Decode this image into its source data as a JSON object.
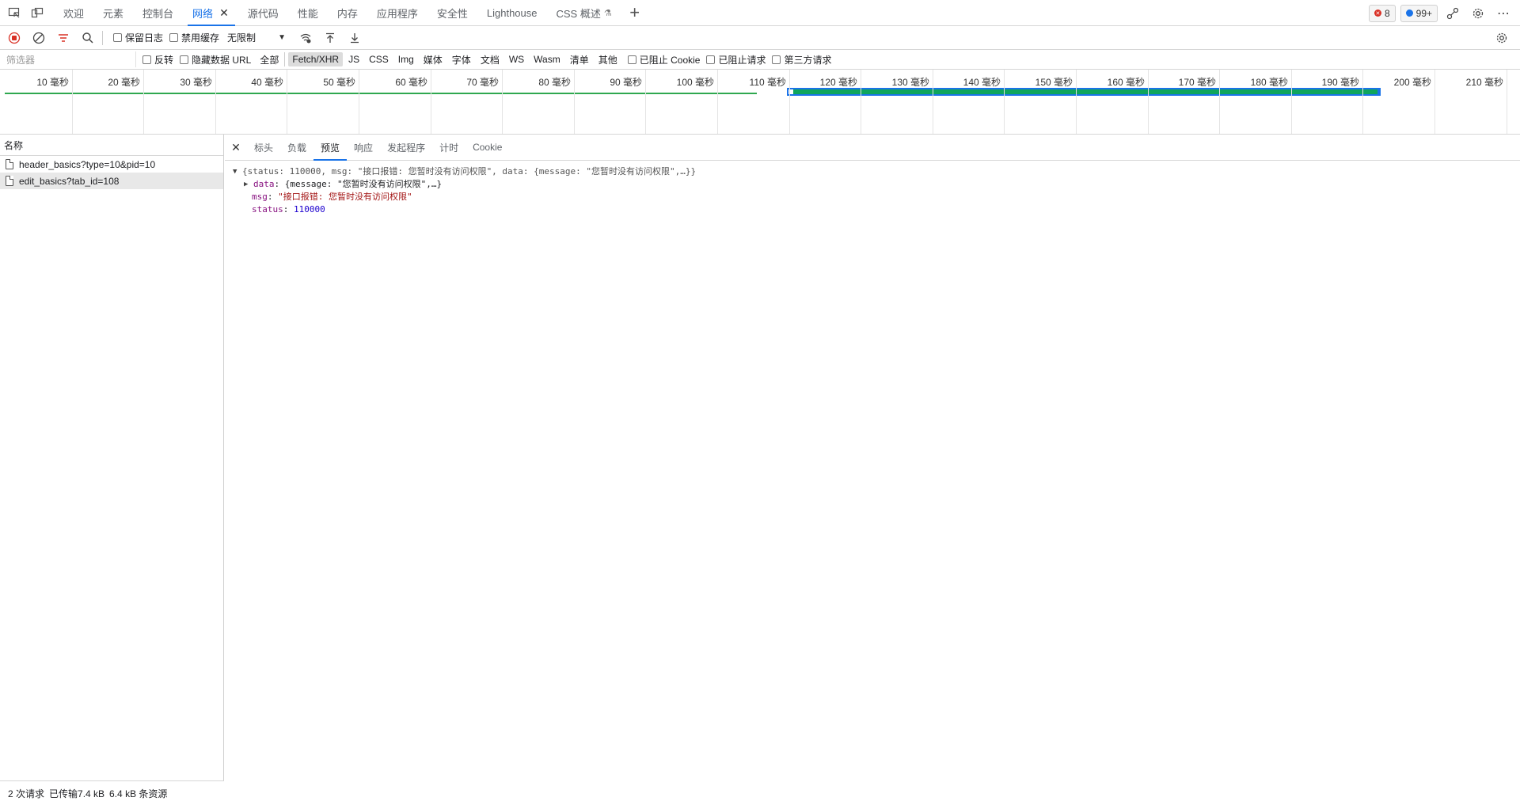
{
  "tabstrip": {
    "tabs": [
      {
        "label": "欢迎"
      },
      {
        "label": "元素"
      },
      {
        "label": "控制台"
      },
      {
        "label": "网络"
      },
      {
        "label": "源代码"
      },
      {
        "label": "性能"
      },
      {
        "label": "内存"
      },
      {
        "label": "应用程序"
      },
      {
        "label": "安全性"
      },
      {
        "label": "Lighthouse"
      },
      {
        "label": "CSS 概述"
      }
    ],
    "active_tab": "网络",
    "error_count": "8",
    "issue_count": "99+"
  },
  "toolbar": {
    "preserve_log": "保留日志",
    "disable_cache": "禁用缓存",
    "throttling": "无限制"
  },
  "filterbar": {
    "filter_placeholder": "筛选器",
    "invert": "反转",
    "hide_data_urls": "隐藏数据 URL",
    "types": [
      "全部",
      "Fetch/XHR",
      "JS",
      "CSS",
      "Img",
      "媒体",
      "字体",
      "文档",
      "WS",
      "Wasm",
      "清单",
      "其他"
    ],
    "active_type": "Fetch/XHR",
    "blocked_cookies": "已阻止 Cookie",
    "blocked_requests": "已阻止请求",
    "third_party": "第三方请求"
  },
  "timeline": {
    "ticks": [
      "10 毫秒",
      "20 毫秒",
      "30 毫秒",
      "40 毫秒",
      "50 毫秒",
      "60 毫秒",
      "70 毫秒",
      "80 毫秒",
      "90 毫秒",
      "100 毫秒",
      "110 毫秒",
      "120 毫秒",
      "130 毫秒",
      "140 毫秒",
      "150 毫秒",
      "160 毫秒",
      "170 毫秒",
      "180 毫秒",
      "190 毫秒",
      "200 毫秒",
      "210 毫秒"
    ]
  },
  "requests": {
    "header": "名称",
    "items": [
      {
        "name": "header_basics?type=10&pid=10"
      },
      {
        "name": "edit_basics?tab_id=108"
      }
    ],
    "summary": {
      "count": "2 次请求",
      "transferred": "已传输7.4 kB",
      "resources": "6.4 kB 条资源"
    }
  },
  "detail": {
    "tabs": [
      "标头",
      "负载",
      "预览",
      "响应",
      "发起程序",
      "计时",
      "Cookie"
    ],
    "active_tab": "预览",
    "preview": {
      "summary": "{status: 110000, msg: \"接口报错: 您暂时没有访问权限\", data: {message: \"您暂时没有访问权限\",…}}",
      "data_key": "data",
      "data_value": "{message: \"您暂时没有访问权限\",…}",
      "msg_key": "msg",
      "msg_value": "\"接口报错: 您暂时没有访问权限\"",
      "status_key": "status",
      "status_value": "110000"
    }
  }
}
